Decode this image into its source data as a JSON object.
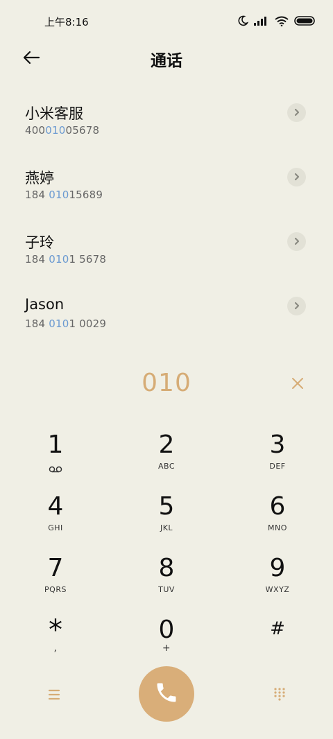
{
  "status_bar": {
    "time": "上午8:16",
    "icons": [
      "moon-icon",
      "signal-icon",
      "wifi-icon",
      "battery-icon"
    ]
  },
  "header": {
    "title": "通话",
    "back_icon": "back-arrow-icon"
  },
  "contacts": [
    {
      "name": "小米客服",
      "number_pre": "400",
      "number_match": "010",
      "number_post": "05678"
    },
    {
      "name": "燕婷",
      "number_pre": "184 ",
      "number_match": "010",
      "number_post": "15689"
    },
    {
      "name": "子玲",
      "number_pre": "184 ",
      "number_match": "010",
      "number_post": "1 5678"
    },
    {
      "name": "Jason",
      "number_pre": "184 ",
      "number_match": "010",
      "number_post": "1 0029"
    }
  ],
  "dialer": {
    "input": "010",
    "clear_icon": "close-icon"
  },
  "keypad": [
    {
      "digit": "1",
      "letters": ""
    },
    {
      "digit": "2",
      "letters": "ABC"
    },
    {
      "digit": "3",
      "letters": "DEF"
    },
    {
      "digit": "4",
      "letters": "GHI"
    },
    {
      "digit": "5",
      "letters": "JKL"
    },
    {
      "digit": "6",
      "letters": "MNO"
    },
    {
      "digit": "7",
      "letters": "PQRS"
    },
    {
      "digit": "8",
      "letters": "TUV"
    },
    {
      "digit": "9",
      "letters": "WXYZ"
    },
    {
      "digit": "*",
      "letters": ","
    },
    {
      "digit": "0",
      "letters": "+"
    },
    {
      "digit": "#",
      "letters": ""
    }
  ],
  "bottom_bar": {
    "menu_icon": "menu-icon",
    "call_icon": "phone-icon",
    "keypad_icon": "keypad-icon"
  },
  "colors": {
    "background": "#f0efe5",
    "accent": "#d9ae79",
    "match_highlight": "#6b9ad1"
  }
}
